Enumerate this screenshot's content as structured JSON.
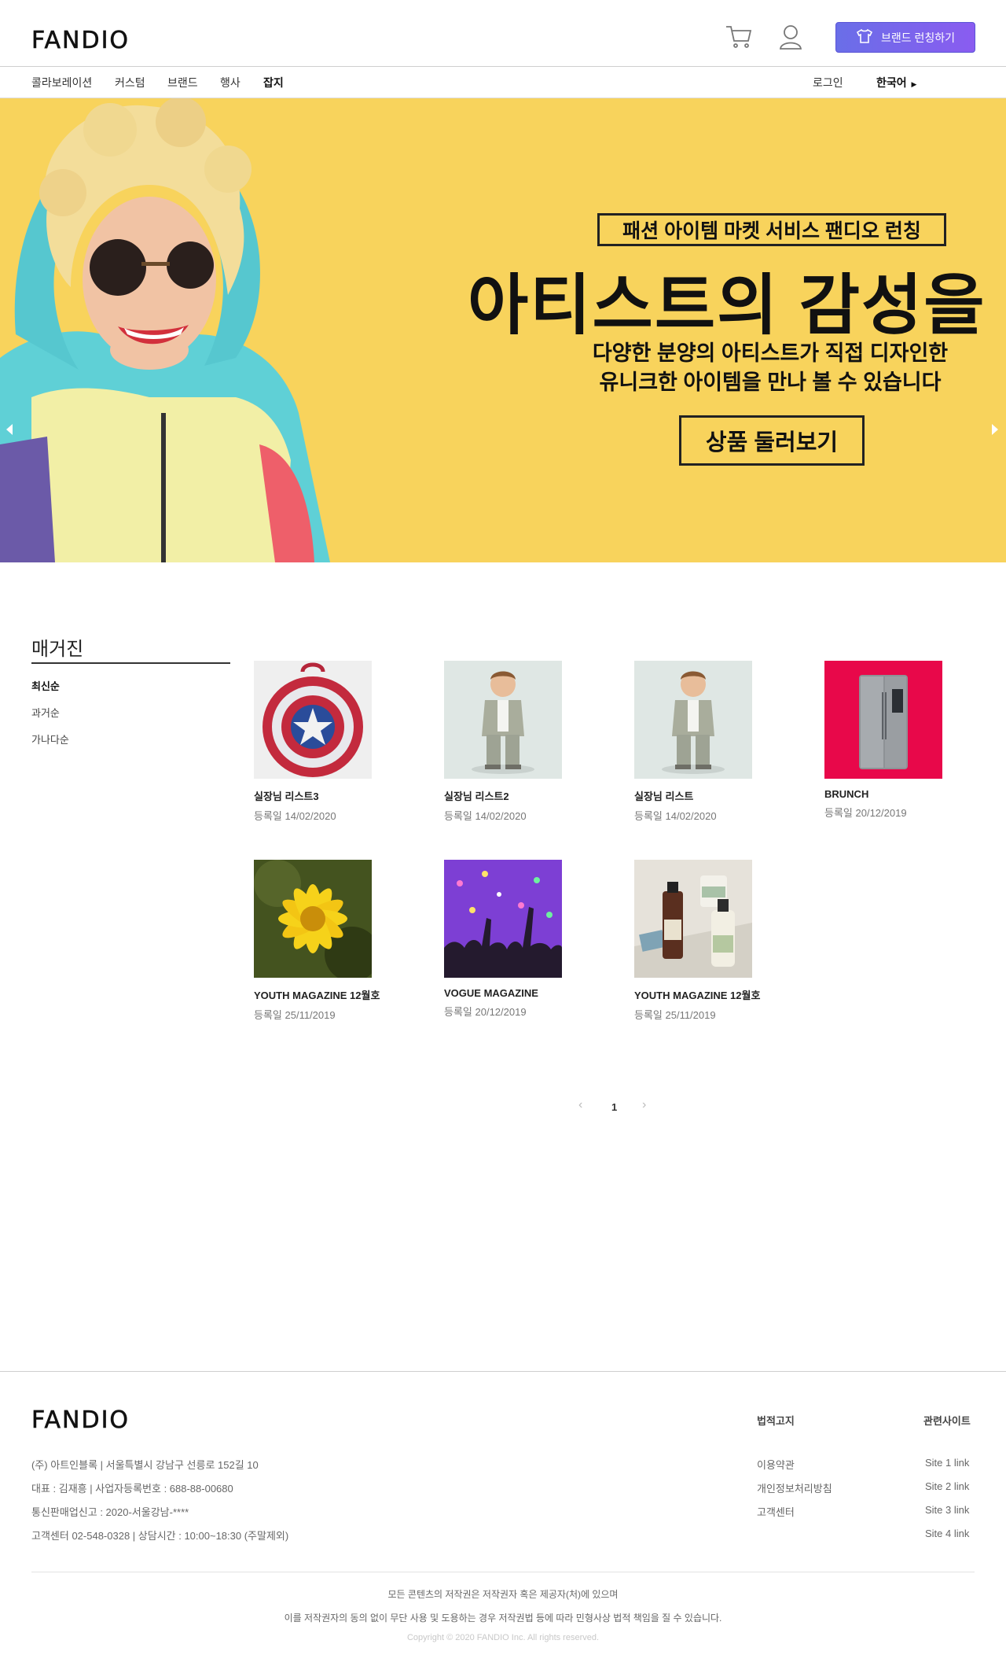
{
  "brand": {
    "logo": "FANDIO"
  },
  "header": {
    "cart_icon": "cart-icon",
    "user_icon": "user-icon",
    "launch_button": "브랜드 런칭하기",
    "accent_color": "#7464ec"
  },
  "nav": {
    "items": [
      {
        "label": "콜라보레이션"
      },
      {
        "label": "커스텀"
      },
      {
        "label": "브랜드"
      },
      {
        "label": "행사"
      },
      {
        "label": "잡지"
      }
    ],
    "login": "로그인",
    "language": "한국어"
  },
  "hero": {
    "tag": "패션 아이템 마켓 서비스 팬디오 런칭",
    "title": "아티스트의 감성을 입",
    "subtitle_line1": "다양한 분양의 아티스트가 직접 디자인한",
    "subtitle_line2": "유니크한 아이템을 만나 볼 수 있습니다",
    "cta": "상품 둘러보기",
    "background_color": "#f8d35c"
  },
  "magazine": {
    "title": "매거진",
    "sort": [
      {
        "label": "최신순"
      },
      {
        "label": "과거순"
      },
      {
        "label": "가나다순"
      }
    ],
    "cards": [
      {
        "title": "실장님 리스트3",
        "date": "등록일 14/02/2020",
        "image": "shield-backpack"
      },
      {
        "title": "실장님 리스트2",
        "date": "등록일 14/02/2020",
        "image": "kid-photo"
      },
      {
        "title": "실장님 리스트",
        "date": "등록일 14/02/2020",
        "image": "kid-photo"
      },
      {
        "title": "BRUNCH",
        "date": "등록일 20/12/2019",
        "image": "refrigerator"
      },
      {
        "title": "YOUTH MAGAZINE 12월호",
        "date": "등록일 25/11/2019",
        "image": "yellow-flower"
      },
      {
        "title": "VOGUE MAGAZINE",
        "date": "등록일 20/12/2019",
        "image": "concert-crowd"
      },
      {
        "title": "YOUTH MAGAZINE 12월호",
        "date": "등록일 25/11/2019",
        "image": "cosmetics-bottles"
      }
    ],
    "pagination": {
      "prev": "‹",
      "current": "1",
      "next": "›"
    }
  },
  "footer": {
    "logo": "FANDIO",
    "info": [
      "(주) 아트인블록 | 서울특별시 강남구 선릉로 152길 10",
      "대표 : 김재흥 | 사업자등록번호 : 688-88-00680",
      "통신판매업신고 : 2020-서울강남-****",
      "고객센터 02-548-0328 | 상담시간 : 10:00~18:30 (주말제외)"
    ],
    "legal_title": "법적고지",
    "legal_links": [
      "이용약관",
      "개인정보처리방침",
      "고객센터"
    ],
    "related_title": "관련사이트",
    "related_links": [
      "Site 1 link",
      "Site 2 link",
      "Site 3 link",
      "Site 4 link"
    ],
    "notice_line1": "모든 콘텐츠의 저작권은 저작권자 혹은 제공자(처)에 있으며",
    "notice_line2": "이를 저작권자의 동의 없이 무단 사용 및 도용하는 경우 저작권법 등에 따라 민형사상 법적 책임을 질 수 있습니다.",
    "copyright": "Copyright © 2020 FANDIO Inc. All rights reserved."
  }
}
